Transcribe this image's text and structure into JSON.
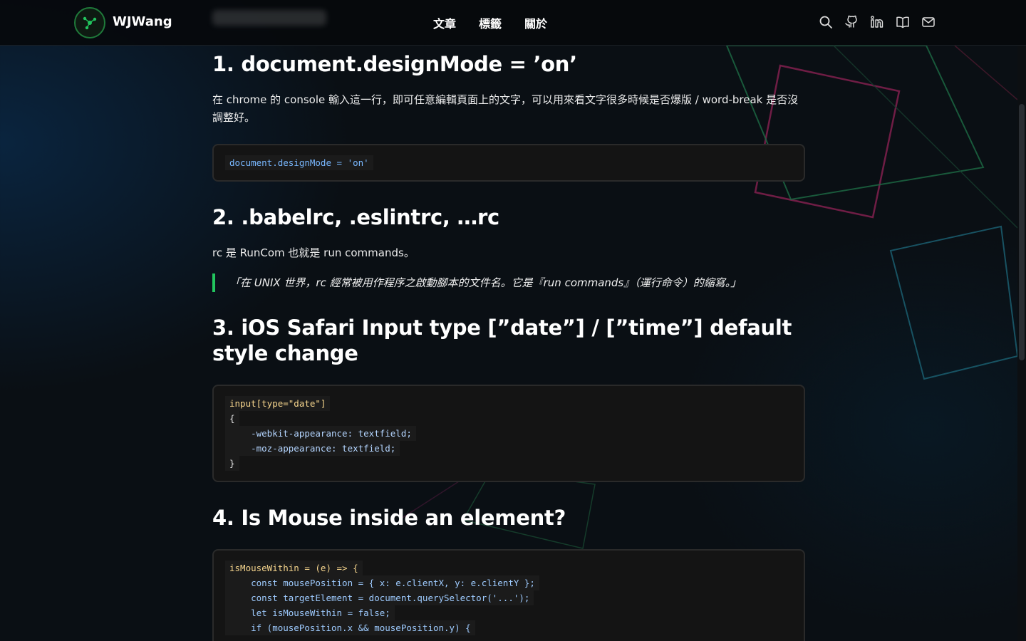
{
  "header": {
    "brand": "WJWang",
    "nav": [
      "文章",
      "標籤",
      "關於"
    ],
    "icons": [
      "search-icon",
      "github-icon",
      "linkedin-icon",
      "book-icon",
      "mail-icon"
    ]
  },
  "sections": [
    {
      "title": "1. document.designMode = ’on’",
      "paragraph": "在 chrome 的 console 輸入這一行，即可任意編輯頁面上的文字，可以用來看文字很多時候是否爆版 / word-break 是否沒調整好。",
      "code": "document.designMode = 'on'"
    },
    {
      "title": "2. .babelrc, .eslintrc, …rc",
      "paragraph": "rc 是 RunCom 也就是 run commands。",
      "quote": "「在 UNIX 世界，rc 經常被用作程序之啟動腳本的文件名。它是『run commands』（運行命令）的縮寫。」"
    },
    {
      "title": "3. iOS Safari Input type [”date”] / [”time”] default style change",
      "code_lines": [
        "input[type=\"date\"]",
        "{",
        "    -webkit-appearance: textfield;",
        "    -moz-appearance: textfield;",
        "}"
      ]
    },
    {
      "title": "4. Is Mouse inside an element?",
      "code_lines": [
        "isMouseWithin = (e) => {",
        "    const mousePosition = { x: e.clientX, y: e.clientY };",
        "    const targetElement = document.querySelector('...');",
        "    let isMouseWithin = false;",
        "    if (mousePosition.x && mousePosition.y) {"
      ]
    }
  ],
  "colors": {
    "accent": "#22c55e",
    "background": "#0a0f14",
    "code_bg": "#141414"
  }
}
